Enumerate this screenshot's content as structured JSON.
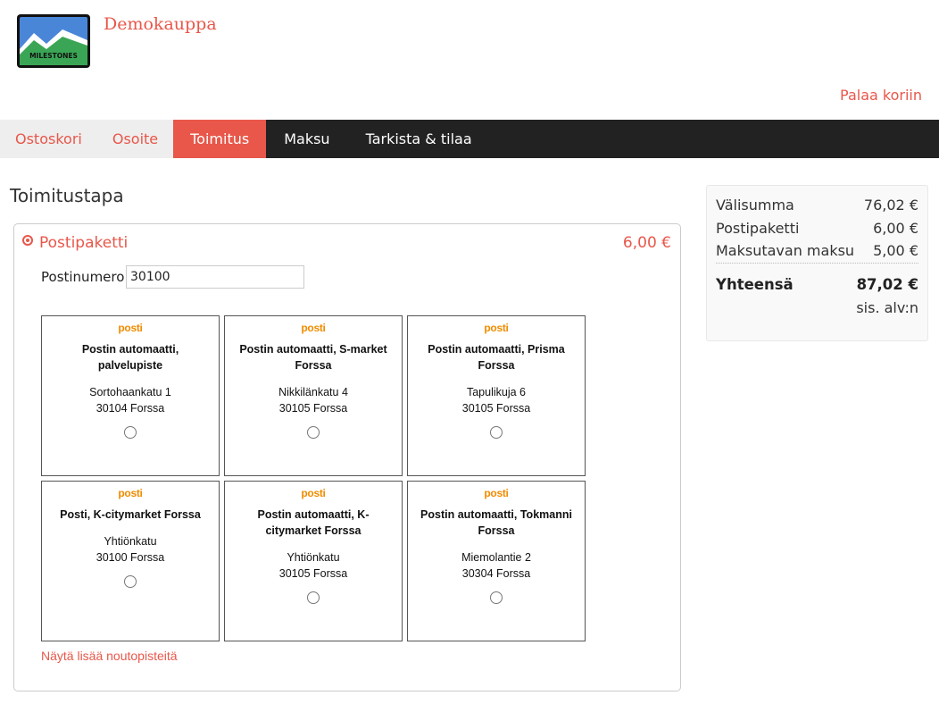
{
  "header": {
    "logo_text": "MILESTONES",
    "store_name": "Demokauppa",
    "back_link": "Palaa koriin"
  },
  "steps": [
    {
      "label": "Ostoskori",
      "state": "done"
    },
    {
      "label": "Osoite",
      "state": "done"
    },
    {
      "label": "Toimitus",
      "state": "active"
    },
    {
      "label": "Maksu",
      "state": "todo"
    },
    {
      "label": "Tarkista & tilaa",
      "state": "todo"
    }
  ],
  "section_title": "Toimitustapa",
  "shipping": {
    "method_name": "Postipaketti",
    "method_price": "6,00 €",
    "selected": true,
    "zip_label": "Postinumero *",
    "zip_value": "30100",
    "carrier_logo": "posti",
    "pickup_points": [
      {
        "name": "Postin automaatti, palvelupiste",
        "street": "Sortohaankatu 1",
        "city": "30104 Forssa"
      },
      {
        "name": "Postin automaatti, S-market Forssa",
        "street": "Nikkilänkatu 4",
        "city": "30105 Forssa"
      },
      {
        "name": "Postin automaatti, Prisma Forssa",
        "street": "Tapulikuja 6",
        "city": "30105 Forssa"
      },
      {
        "name": "Posti, K-citymarket Forssa",
        "street": "Yhtiönkatu",
        "city": "30100 Forssa"
      },
      {
        "name": "Postin automaatti, K-citymarket Forssa",
        "street": "Yhtiönkatu",
        "city": "30105 Forssa"
      },
      {
        "name": "Postin automaatti, Tokmanni Forssa",
        "street": "Miemolantie 2",
        "city": "30304 Forssa"
      }
    ],
    "more_link": "Näytä lisää noutopisteitä"
  },
  "summary": {
    "rows": [
      {
        "label": "Välisumma",
        "value": "76,02 €"
      },
      {
        "label": "Postipaketti",
        "value": "6,00 €"
      },
      {
        "label": "Maksutavan maksu",
        "value": "5,00 €"
      }
    ],
    "total_label": "Yhteensä",
    "total_value": "87,02 €",
    "vat_note": "sis. alv:n"
  },
  "colors": {
    "accent": "#e8574a",
    "nav_bg": "#222222",
    "posti_orange": "#f08c00"
  }
}
